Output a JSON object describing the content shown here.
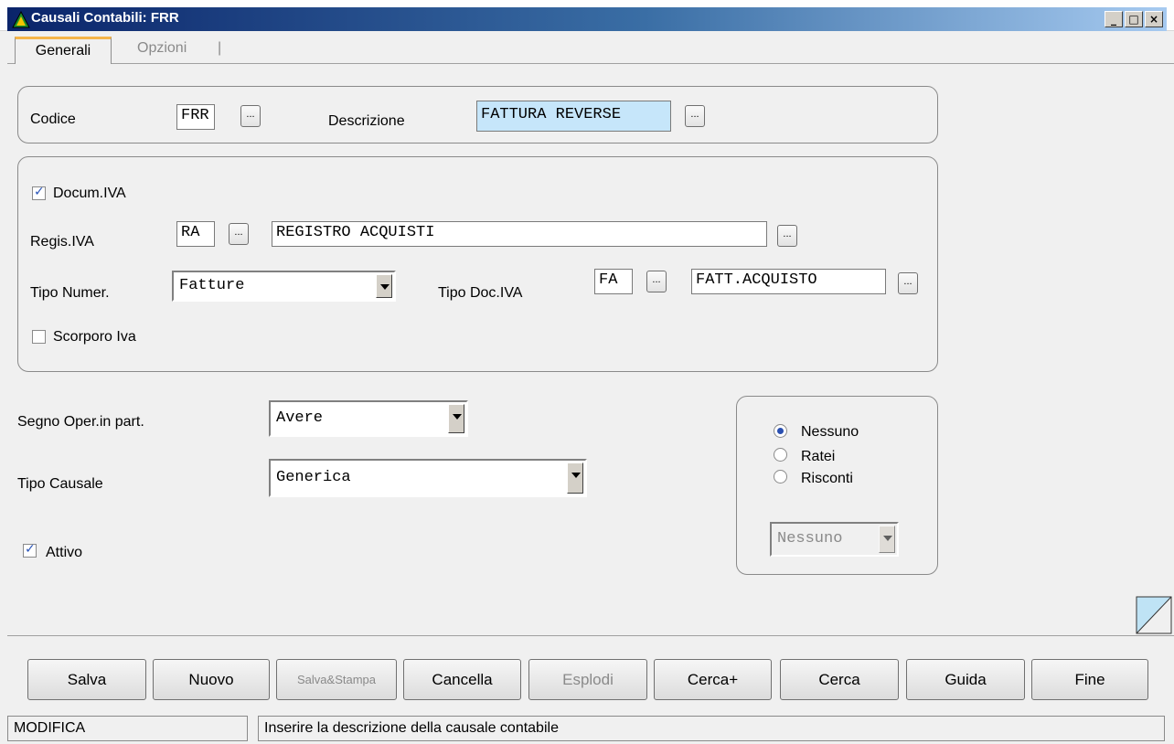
{
  "window": {
    "title": "Causali Contabili: FRR"
  },
  "tabs": [
    {
      "label": "Generali"
    },
    {
      "label": "Opzioni"
    }
  ],
  "codice": {
    "label": "Codice",
    "value": "FRR"
  },
  "descrizione": {
    "label": "Descrizione",
    "value": "FATTURA REVERSE"
  },
  "docum_iva": {
    "label": "Docum.IVA",
    "checked": true
  },
  "regis_iva": {
    "label": "Regis.IVA",
    "code": "RA",
    "desc": "REGISTRO ACQUISTI"
  },
  "tipo_numer": {
    "label": "Tipo Numer.",
    "value": "Fatture"
  },
  "tipo_doc_iva": {
    "label": "Tipo Doc.IVA",
    "code": "FA",
    "desc": "FATT.ACQUISTO"
  },
  "scorporo_iva": {
    "label": "Scorporo Iva",
    "checked": false
  },
  "segno_oper": {
    "label": "Segno Oper.in part.",
    "value": "Avere"
  },
  "tipo_causale": {
    "label": "Tipo Causale",
    "value": "Generica"
  },
  "attivo": {
    "label": "Attivo",
    "checked": true
  },
  "ratei": {
    "options": [
      {
        "label": "Nessuno",
        "selected": true
      },
      {
        "label": "Ratei",
        "selected": false
      },
      {
        "label": "Risconti",
        "selected": false
      }
    ],
    "combo_value": "Nessuno"
  },
  "dots_label": "...",
  "buttons": {
    "salva": "Salva",
    "nuovo": "Nuovo",
    "salva_stampa": "Salva&Stampa",
    "cancella": "Cancella",
    "esplodi": "Esplodi",
    "cerca_plus": "Cerca+",
    "cerca": "Cerca",
    "guida": "Guida",
    "fine": "Fine"
  },
  "status": {
    "mode": "MODIFICA",
    "message": "Inserire la descrizione della causale contabile"
  },
  "colors": {
    "titlebar": "#0a246a",
    "tab_accent": "#f5b54a",
    "highlight_field": "#c6e6fa"
  }
}
